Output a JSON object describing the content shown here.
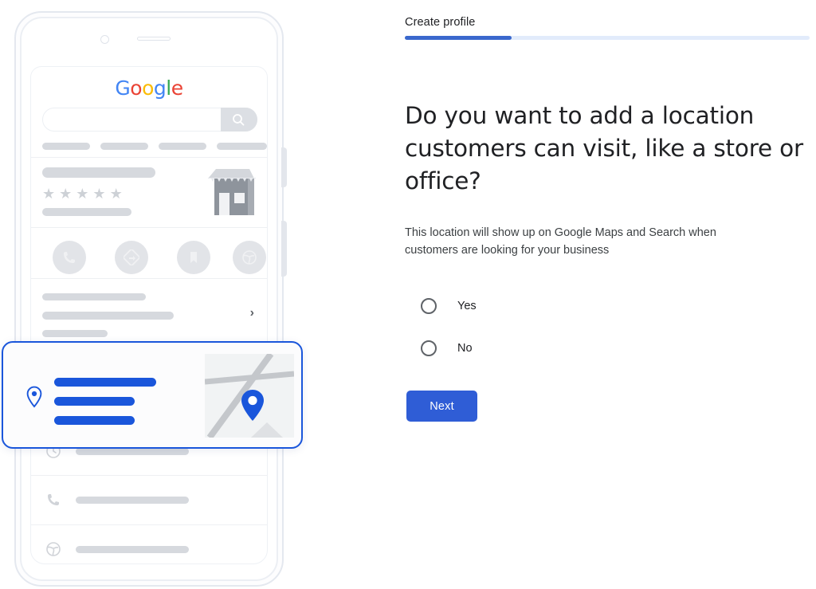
{
  "form": {
    "step_tab_label": "Create profile",
    "progress_percent": 26,
    "heading": "Do you want to add a location customers can visit, like a store or office?",
    "description": "This location will show up on Google Maps and Search when customers are looking for your business",
    "options": [
      {
        "label": "Yes",
        "value": "yes",
        "selected": false
      },
      {
        "label": "No",
        "value": "no",
        "selected": false
      }
    ],
    "next_label": "Next"
  },
  "illustration": {
    "device": "android-phone-mockup",
    "brand_logo": {
      "name": "google-logo",
      "letters": [
        {
          "char": "G",
          "color": "#4285F4"
        },
        {
          "char": "o",
          "color": "#EA4335"
        },
        {
          "char": "o",
          "color": "#FBBC05"
        },
        {
          "char": "g",
          "color": "#4285F4"
        },
        {
          "char": "l",
          "color": "#34A853"
        },
        {
          "char": "e",
          "color": "#EA4335"
        }
      ]
    },
    "search_placeholder": "",
    "business_listing": {
      "star_count": 5,
      "star_glyph": "★",
      "thumbnail_icon": "storefront-icon"
    },
    "action_icons": [
      "call-icon",
      "directions-icon",
      "save-icon",
      "website-icon"
    ],
    "detail_rows": [
      "clock-icon",
      "phone-icon",
      "globe-icon"
    ],
    "location_card": {
      "highlighted": true,
      "accent_color": "#1a56db",
      "pin_icon": "location-pin-icon",
      "map_icon": "map-thumbnail-with-pin"
    }
  },
  "colors": {
    "accent_blue": "#2f5dd6",
    "progress_fill": "#3a68cd",
    "progress_track": "#e2ebfb",
    "card_highlight": "#1a56db",
    "placeholder_gray": "#d6d9de"
  }
}
